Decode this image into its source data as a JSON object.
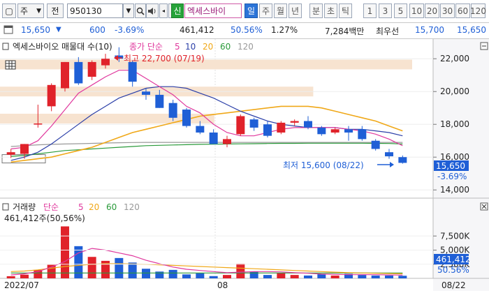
{
  "toolbar": {
    "period_select": "주",
    "jeon_label": "전",
    "code": "950130",
    "stock_name": "엑세스바이",
    "period_tabs": [
      "일",
      "주",
      "월",
      "년"
    ],
    "minute_tabs": [
      "분",
      "초",
      "틱"
    ],
    "number_tabs": [
      "1",
      "3",
      "5",
      "10",
      "20",
      "30",
      "60",
      "120"
    ]
  },
  "pricebar": {
    "price": "15,650",
    "change_arrow": "▼",
    "change": "600",
    "change_pct": "-3.69%",
    "volume": "461,412",
    "vol_ratio": "50.56%",
    "turnover": "1.27%",
    "amount": "7,284백만",
    "best_ask_label": "최우선",
    "best_ask": "15,700",
    "best_bid": "15,650"
  },
  "price_panel": {
    "title": "엑세스바이오 매물대 수(10)",
    "ma_label": "종가 단순",
    "ma_periods": [
      "5",
      "10",
      "20",
      "60",
      "120"
    ],
    "high_annotation": "최고 22,700 (07/19)",
    "low_annotation": "최저 15,600 (08/22)",
    "current_price": "15,650",
    "current_pct": "-3.69%",
    "y_ticks": [
      "22,000",
      "20,000",
      "18,000",
      "16,000",
      "14,000"
    ]
  },
  "volume_panel": {
    "title": "거래량",
    "ma_label": "단순",
    "ma_periods": [
      "5",
      "20",
      "60",
      "120"
    ],
    "info": "461,412주(50,56%)",
    "y_ticks": [
      "7,500K",
      "5,000K",
      "2,500K"
    ],
    "current_volume": "461,412",
    "current_pct": "50.56%"
  },
  "x_axis": {
    "labels": [
      "2022/07",
      "08",
      "08/22"
    ]
  },
  "colors": {
    "up": "#e0222a",
    "down": "#1f5fd6",
    "ma5": "#e0389d",
    "ma10": "#2b3fa8",
    "ma20": "#f0a818",
    "ma60": "#2a9a3a",
    "ma120": "#999999",
    "brand": "#2b74d8"
  },
  "chart_data": {
    "type": "candlestick",
    "title": "엑세스바이오 매물대 수(10)",
    "ylim": [
      13500,
      23200
    ],
    "candles": [
      {
        "o": 16150,
        "h": 16500,
        "l": 15950,
        "c": 16300
      },
      {
        "o": 16200,
        "h": 16800,
        "l": 15900,
        "c": 16800
      },
      {
        "o": 18000,
        "h": 19200,
        "l": 17800,
        "c": 18050
      },
      {
        "o": 19100,
        "h": 20500,
        "l": 18800,
        "c": 20400
      },
      {
        "o": 20200,
        "h": 21800,
        "l": 20000,
        "c": 21800
      },
      {
        "o": 21800,
        "h": 22100,
        "l": 20400,
        "c": 20500
      },
      {
        "o": 20900,
        "h": 21900,
        "l": 20700,
        "c": 21800
      },
      {
        "o": 21600,
        "h": 22300,
        "l": 21400,
        "c": 22000
      },
      {
        "o": 22200,
        "h": 22700,
        "l": 21800,
        "c": 22000
      },
      {
        "o": 21800,
        "h": 21900,
        "l": 20300,
        "c": 20600
      },
      {
        "o": 20000,
        "h": 20200,
        "l": 19500,
        "c": 19800
      },
      {
        "o": 19800,
        "h": 20100,
        "l": 19000,
        "c": 19000
      },
      {
        "o": 19300,
        "h": 19500,
        "l": 18200,
        "c": 18400
      },
      {
        "o": 18900,
        "h": 19000,
        "l": 17800,
        "c": 17900
      },
      {
        "o": 17900,
        "h": 18200,
        "l": 17400,
        "c": 17500
      },
      {
        "o": 17500,
        "h": 17700,
        "l": 16800,
        "c": 16800
      },
      {
        "o": 16800,
        "h": 17300,
        "l": 16600,
        "c": 17100
      },
      {
        "o": 17400,
        "h": 18600,
        "l": 17300,
        "c": 18500
      },
      {
        "o": 18300,
        "h": 18400,
        "l": 17600,
        "c": 17800
      },
      {
        "o": 18000,
        "h": 18200,
        "l": 17200,
        "c": 17300
      },
      {
        "o": 17500,
        "h": 18200,
        "l": 17400,
        "c": 18100
      },
      {
        "o": 18100,
        "h": 18300,
        "l": 17900,
        "c": 18200
      },
      {
        "o": 18200,
        "h": 18500,
        "l": 17700,
        "c": 17800
      },
      {
        "o": 17800,
        "h": 17900,
        "l": 17300,
        "c": 17400
      },
      {
        "o": 17500,
        "h": 17800,
        "l": 17400,
        "c": 17700
      },
      {
        "o": 17700,
        "h": 17900,
        "l": 17000,
        "c": 17500
      },
      {
        "o": 17700,
        "h": 17900,
        "l": 17000,
        "c": 17100
      },
      {
        "o": 17000,
        "h": 17100,
        "l": 16400,
        "c": 16500
      },
      {
        "o": 16300,
        "h": 16500,
        "l": 15900,
        "c": 16050
      },
      {
        "o": 16000,
        "h": 16100,
        "l": 15600,
        "c": 15650
      }
    ],
    "ma5": [
      16500,
      16600,
      17000,
      17900,
      18900,
      19900,
      20400,
      20900,
      21300,
      21300,
      20800,
      20300,
      19800,
      19100,
      18700,
      18000,
      17500,
      17300,
      17300,
      17500,
      17700,
      17800,
      17800,
      17800,
      17800,
      17700,
      17600,
      17400,
      17100,
      16700
    ],
    "ma10": [
      15800,
      16000,
      16300,
      16800,
      17400,
      18000,
      18600,
      19100,
      19600,
      19900,
      20200,
      20300,
      20300,
      20200,
      19900,
      19600,
      19200,
      18800,
      18500,
      18200,
      18000,
      17900,
      17800,
      17800,
      17800,
      17700,
      17700,
      17600,
      17500,
      17300
    ],
    "ma20": [
      15700,
      15800,
      15900,
      16000,
      16200,
      16400,
      16600,
      16900,
      17200,
      17500,
      17700,
      17900,
      18100,
      18300,
      18500,
      18600,
      18700,
      18800,
      18900,
      19000,
      19100,
      19100,
      19100,
      19000,
      18800,
      18600,
      18400,
      18200,
      17900,
      17600
    ],
    "ma60": [
      16050,
      16100,
      16200,
      16300,
      16400,
      16450,
      16500,
      16550,
      16600,
      16650,
      16700,
      16720,
      16740,
      16760,
      16780,
      16790,
      16800,
      16810,
      16820,
      16830,
      16840,
      16840,
      16850,
      16850,
      16850,
      16850,
      16850,
      16840,
      16830,
      16800
    ],
    "ma120": [
      16650,
      16700,
      16750,
      16780,
      16800,
      16820,
      16840,
      16860,
      16880,
      16890,
      16900,
      16900,
      16900,
      16900,
      16900,
      16900,
      16900,
      16900,
      16900,
      16900,
      16900,
      16900,
      16900,
      16900,
      16900,
      16900,
      16900,
      16900,
      16900,
      16900
    ],
    "volume_profile": [
      {
        "price": 21650,
        "weight": 1.0
      },
      {
        "price": 20000,
        "weight": 0.76
      },
      {
        "price": 18350,
        "weight": 0.52
      }
    ],
    "volumes": [
      380,
      650,
      1500,
      2400,
      9200,
      5700,
      3800,
      3100,
      3600,
      2800,
      1700,
      1200,
      1500,
      700,
      900,
      400,
      600,
      2600,
      1200,
      600,
      900,
      600,
      500,
      800,
      500,
      800,
      600,
      500,
      500,
      460
    ],
    "vol_ma5": [
      600,
      800,
      1200,
      2000,
      3000,
      4500,
      5300,
      5000,
      4500,
      4000,
      3200,
      2600,
      2000,
      1600,
      1400,
      1200,
      1000,
      1100,
      1200,
      1200,
      1150,
      1000,
      900,
      750,
      700,
      650,
      650,
      650,
      600,
      580
    ],
    "vol_ma20": [
      1200,
      1300,
      1500,
      1800,
      2100,
      2300,
      2500,
      2600,
      2600,
      2550,
      2500,
      2400,
      2300,
      2200,
      2100,
      2000,
      1900,
      1800,
      1700,
      1600,
      1500,
      1400,
      1300,
      1200,
      1100,
      1000,
      950,
      900,
      850,
      800
    ],
    "vol_ma60": [
      950,
      950,
      950,
      950,
      950,
      950,
      950,
      950,
      950,
      950,
      950,
      950,
      950,
      950,
      950,
      950,
      950,
      950,
      950,
      950,
      950,
      950,
      950,
      950,
      950,
      950,
      950,
      950,
      950,
      950
    ],
    "vol_ylim": [
      0,
      10500
    ]
  }
}
